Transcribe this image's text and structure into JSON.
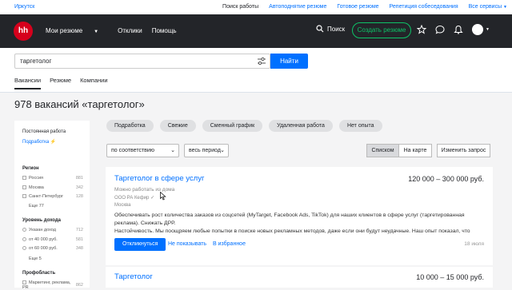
{
  "topbar": {
    "city": "Иркутск",
    "links": [
      "Поиск работы",
      "Автоподнятие резюме",
      "Готовое резюме",
      "Репетиция собеседования",
      "Все сервисы"
    ]
  },
  "header": {
    "logo": "hh",
    "nav": {
      "resumes": "Мои резюме",
      "responses": "Отклики",
      "help": "Помощь"
    },
    "search_label": "Поиск",
    "create_resume": "Создать резюме",
    "icons": [
      "star-icon",
      "chat-icon",
      "bell-icon",
      "avatar"
    ]
  },
  "search": {
    "value": "таргетолог",
    "button": "Найти",
    "tabs": [
      "Вакансии",
      "Резюме",
      "Компании"
    ]
  },
  "page_title": "978 вакансий «таргетолог»",
  "sidebar": {
    "permanent_label": "Постоянная работа",
    "parttime_label": "Подработка",
    "region": {
      "title": "Регион",
      "items": [
        {
          "label": "Россия",
          "count": "881"
        },
        {
          "label": "Москва",
          "count": "342"
        },
        {
          "label": "Санкт-Петербург",
          "count": "128"
        }
      ],
      "more": "Еще 77"
    },
    "income": {
      "title": "Уровень дохода",
      "items": [
        {
          "label": "Указан доход",
          "count": "712"
        },
        {
          "label": "от 40 000 руб.",
          "count": "581"
        },
        {
          "label": "от 60 000 руб.",
          "count": "348"
        }
      ],
      "more": "Еще 5"
    },
    "prof": {
      "title": "Профобласть",
      "items": [
        {
          "label": "Маркетинг, реклама, PR",
          "count": "862"
        }
      ]
    }
  },
  "chips": [
    "Подработка",
    "Свежие",
    "Сменный график",
    "Удаленная работа",
    "Нет опыта"
  ],
  "controls": {
    "sort": "по соответствию",
    "period": "весь период",
    "view_list": "Списком",
    "view_map": "На карте",
    "change_query": "Изменить запрос"
  },
  "vacancies": [
    {
      "title": "Таргетолог в сфере услуг",
      "salary": "120 000 – 300 000 руб.",
      "remote": "Можно работать из дома",
      "company": "ООО РА Кефир",
      "city": "Москва",
      "description": "Обеспечивать рост количества заказов из соцсетей (MyTarget, Facebook Ads, TikTok) для наших клиентов в сфере услуг (таргетированная реклама). Снижать ДРР.",
      "description2": "Настойчивость. Мы поощряем любые попытки в поиске новых рекламных методов, даже если они будут неудачные. Наш опыт показал, что добиться...",
      "respond": "Откликнуться",
      "hide": "Не показывать",
      "favorite": "В избранное",
      "date": "18 июля"
    },
    {
      "title": "Таргетолог",
      "salary": "10 000 – 15 000 руб."
    }
  ]
}
